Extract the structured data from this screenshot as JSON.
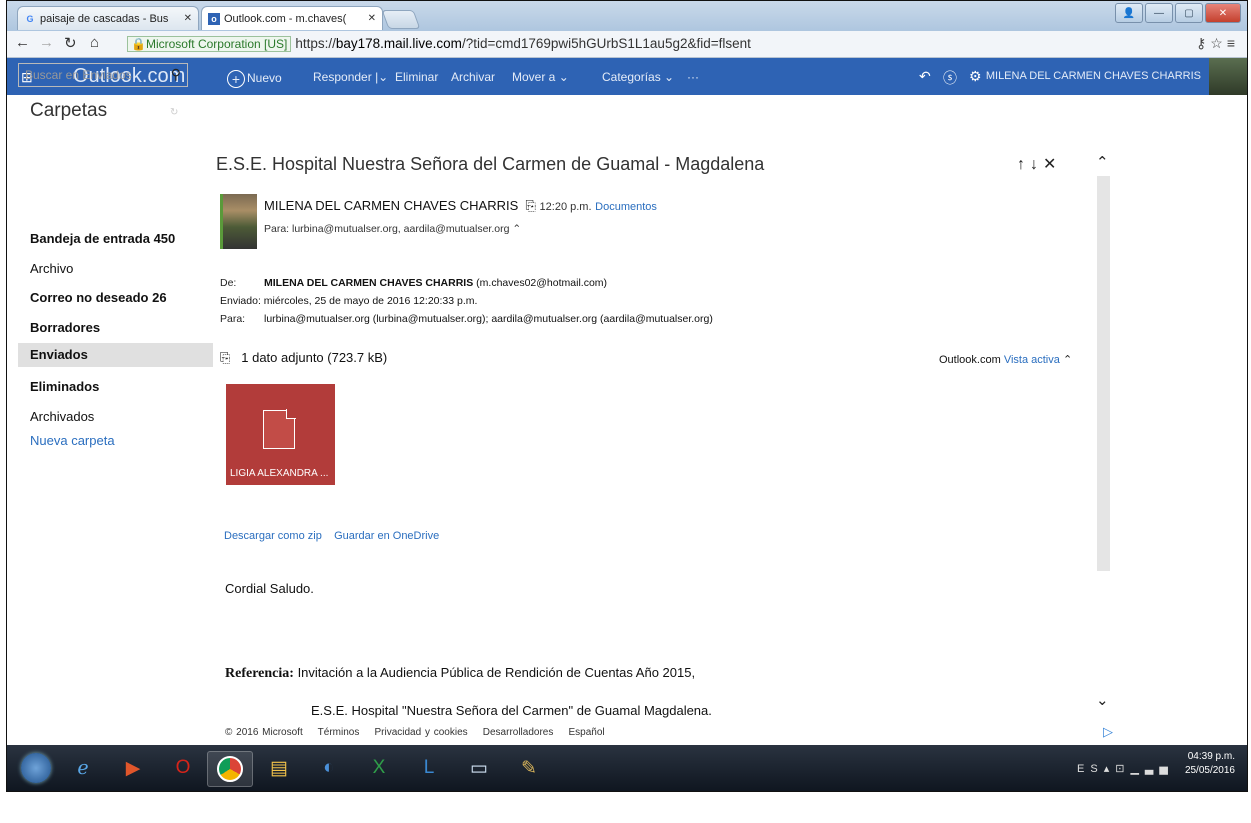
{
  "browser": {
    "tabs": [
      {
        "label": "paisaje de cascadas - Bus"
      },
      {
        "label": "Outlook.com - m.chaves("
      }
    ],
    "ev_label": "Microsoft Corporation [US]",
    "url_prefix": "https://",
    "url_host": "bay178.mail.live.com",
    "url_path": "/?tid=cmd1769pwi5hGUrbS1L1au5g2&fid=flsent"
  },
  "header": {
    "brand": "Outlook.com",
    "commands": {
      "new": "Nuevo",
      "reply": "Responder",
      "delete": "Eliminar",
      "archive": "Archivar",
      "move": "Mover a",
      "categories": "Categorías",
      "more": "···"
    },
    "user_name": "MILENA DEL CARMEN CHAVES CHARRIS"
  },
  "sidebar": {
    "search_placeholder": "Buscar en Enviados",
    "folders_title": "Carpetas",
    "items": [
      {
        "label": "Bandeja de entrada",
        "count": "450"
      },
      {
        "label": "Archivo",
        "count": ""
      },
      {
        "label": "Correo no deseado",
        "count": "26"
      },
      {
        "label": "Borradores",
        "count": ""
      },
      {
        "label": "Enviados",
        "count": ""
      },
      {
        "label": "Eliminados",
        "count": ""
      },
      {
        "label": "Archivados",
        "count": ""
      }
    ],
    "new_folder": "Nueva carpeta"
  },
  "message": {
    "subject": "E.S.E. Hospital Nuestra Señora del Carmen de Guamal - Magdalena",
    "sender": "MILENA DEL CARMEN CHAVES CHARRIS",
    "time": "12:20 p.m.",
    "category": "Documentos",
    "to_line": "Para: lurbina@mutualser.org, aardila@mutualser.org",
    "from_label": "De:",
    "from_value": "MILENA DEL CARMEN CHAVES CHARRIS",
    "from_email": "(m.chaves02@hotmail.com)",
    "sent_label": "Enviado:",
    "sent_value": "miércoles, 25 de mayo de 2016 12:20:33 p.m.",
    "to_label": "Para:",
    "to_value": "lurbina@mutualser.org (lurbina@mutualser.org); aardila@mutualser.org (aardila@mutualser.org)",
    "attachments_label": "1 dato adjunto (723.7 kB)",
    "viewer_label": "Outlook.com",
    "viewer_link": "Vista activa",
    "attachment_name": "LIGIA ALEXANDRA ...",
    "download_zip": "Descargar como zip",
    "save_onedrive": "Guardar en OneDrive",
    "greeting": "Cordial Saludo.",
    "ref_label": "Referencia:",
    "ref_text": "Invitación a la Audiencia Pública de Rendición de Cuentas Año 2015,",
    "ref_cont": "E.S.E. Hospital \"Nuestra Señora del Carmen\" de Guamal Magdalena."
  },
  "footer": {
    "copyright": "© 2016 Microsoft",
    "terms": "Términos",
    "privacy": "Privacidad y cookies",
    "developers": "Desarrolladores",
    "language": "Español"
  },
  "taskbar": {
    "lang": "ES",
    "time": "04:39 p.m.",
    "date": "25/05/2016"
  }
}
